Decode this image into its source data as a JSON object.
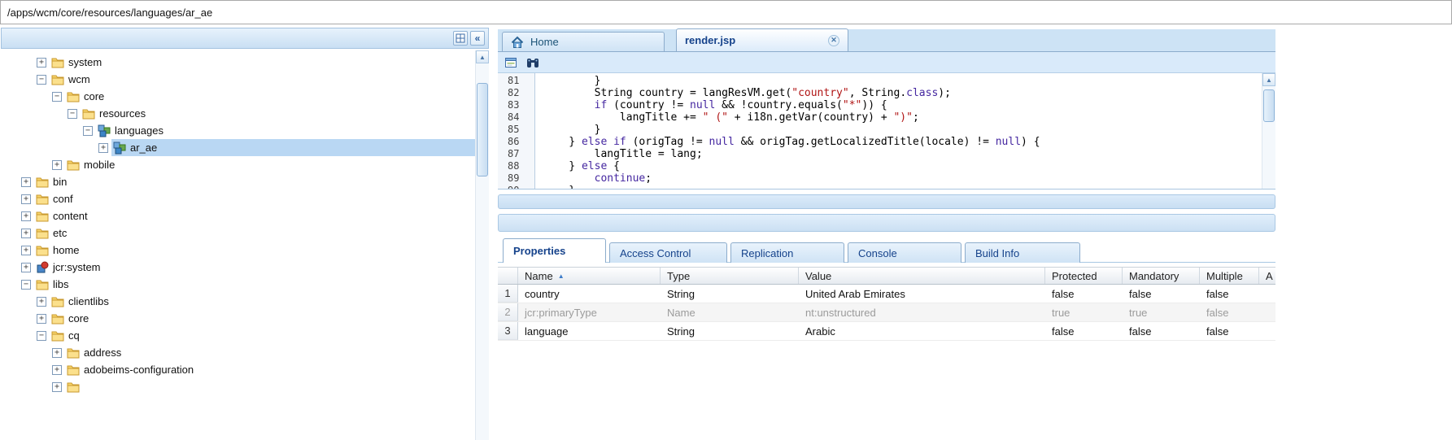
{
  "path_bar": {
    "value": "/apps/wcm/core/resources/languages/ar_ae"
  },
  "left_panel": {
    "header": {
      "collapse_label": "«"
    },
    "tree": [
      {
        "label": "system",
        "level": 3,
        "toggle": "plus",
        "icon": "folder"
      },
      {
        "label": "wcm",
        "level": 3,
        "toggle": "minus",
        "icon": "folder"
      },
      {
        "label": "core",
        "level": 4,
        "toggle": "minus",
        "icon": "folder"
      },
      {
        "label": "resources",
        "level": 5,
        "toggle": "minus",
        "icon": "folder"
      },
      {
        "label": "languages",
        "level": 6,
        "toggle": "minus",
        "icon": "node"
      },
      {
        "label": "ar_ae",
        "level": 7,
        "toggle": "plus",
        "icon": "node",
        "selected": true
      },
      {
        "label": "mobile",
        "level": 4,
        "toggle": "plus",
        "icon": "folder"
      },
      {
        "label": "bin",
        "level": 2,
        "toggle": "plus",
        "icon": "folder"
      },
      {
        "label": "conf",
        "level": 2,
        "toggle": "plus",
        "icon": "folder"
      },
      {
        "label": "content",
        "level": 2,
        "toggle": "plus",
        "icon": "folder"
      },
      {
        "label": "etc",
        "level": 2,
        "toggle": "plus",
        "icon": "folder"
      },
      {
        "label": "home",
        "level": 2,
        "toggle": "plus",
        "icon": "folder"
      },
      {
        "label": "jcr:system",
        "level": 2,
        "toggle": "plus",
        "icon": "system"
      },
      {
        "label": "libs",
        "level": 2,
        "toggle": "minus",
        "icon": "folder"
      },
      {
        "label": "clientlibs",
        "level": 3,
        "toggle": "plus",
        "icon": "folder"
      },
      {
        "label": "core",
        "level": 3,
        "toggle": "plus",
        "icon": "folder"
      },
      {
        "label": "cq",
        "level": 3,
        "toggle": "minus",
        "icon": "folder"
      },
      {
        "label": "address",
        "level": 4,
        "toggle": "plus",
        "icon": "folder"
      },
      {
        "label": "adobeims-configuration",
        "level": 4,
        "toggle": "plus",
        "icon": "folder"
      },
      {
        "label": "",
        "level": 4,
        "toggle": "plus",
        "icon": "folder"
      }
    ]
  },
  "editor": {
    "tabs": [
      {
        "label": "Home",
        "icon": "home",
        "active": false,
        "closable": false
      },
      {
        "label": "render.jsp",
        "active": true,
        "closable": true
      }
    ],
    "code": {
      "first_line": 81,
      "lines": [
        [
          [
            "        }",
            "p"
          ]
        ],
        [
          [
            "        String country = langResVM.get(",
            "p"
          ],
          [
            "\"country\"",
            "s"
          ],
          [
            ", String.",
            "p"
          ],
          [
            "class",
            "k"
          ],
          [
            ");",
            "p"
          ]
        ],
        [
          [
            "        ",
            "p"
          ],
          [
            "if",
            "k"
          ],
          [
            " (country != ",
            "p"
          ],
          [
            "null",
            "k"
          ],
          [
            " && !country.equals(",
            "p"
          ],
          [
            "\"*\"",
            "s"
          ],
          [
            ")) {",
            "p"
          ]
        ],
        [
          [
            "            langTitle += ",
            "p"
          ],
          [
            "\" (\"",
            "s"
          ],
          [
            " + i18n.getVar(country) + ",
            "p"
          ],
          [
            "\")\"",
            "s"
          ],
          [
            ";",
            "p"
          ]
        ],
        [
          [
            "        }",
            "p"
          ]
        ],
        [
          [
            "    } ",
            "p"
          ],
          [
            "else",
            "k"
          ],
          [
            " ",
            "p"
          ],
          [
            "if",
            "k"
          ],
          [
            " (origTag != ",
            "p"
          ],
          [
            "null",
            "k"
          ],
          [
            " && origTag.getLocalizedTitle(locale) != ",
            "p"
          ],
          [
            "null",
            "k"
          ],
          [
            ") {",
            "p"
          ]
        ],
        [
          [
            "        langTitle = lang;",
            "p"
          ]
        ],
        [
          [
            "    } ",
            "p"
          ],
          [
            "else",
            "k"
          ],
          [
            " {",
            "p"
          ]
        ],
        [
          [
            "        ",
            "p"
          ],
          [
            "continue",
            "k"
          ],
          [
            ";",
            "p"
          ]
        ],
        [
          [
            "    }",
            "p"
          ]
        ]
      ]
    }
  },
  "bottom": {
    "tabs": [
      {
        "label": "Properties",
        "active": true
      },
      {
        "label": "Access Control",
        "active": false
      },
      {
        "label": "Replication",
        "active": false
      },
      {
        "label": "Console",
        "active": false
      },
      {
        "label": "Build Info",
        "active": false
      }
    ],
    "table": {
      "columns": [
        {
          "label": "Name",
          "sorted": "asc"
        },
        {
          "label": "Type"
        },
        {
          "label": "Value"
        },
        {
          "label": "Protected"
        },
        {
          "label": "Mandatory"
        },
        {
          "label": "Multiple"
        },
        {
          "label": "A"
        }
      ],
      "rows": [
        {
          "num": "1",
          "muted": false,
          "cells": [
            "country",
            "String",
            "United Arab Emirates",
            "false",
            "false",
            "false"
          ]
        },
        {
          "num": "2",
          "muted": true,
          "cells": [
            "jcr:primaryType",
            "Name",
            "nt:unstructured",
            "true",
            "true",
            "false"
          ]
        },
        {
          "num": "3",
          "muted": false,
          "cells": [
            "language",
            "String",
            "Arabic",
            "false",
            "false",
            "false"
          ]
        }
      ]
    }
  },
  "colors": {
    "chrome_blue": "#cde3f5",
    "border_blue": "#8caccc",
    "selection": "#b9d7f3",
    "keyword": "#4527a0",
    "string": "#b01414",
    "active_tab_text": "#15428b"
  }
}
